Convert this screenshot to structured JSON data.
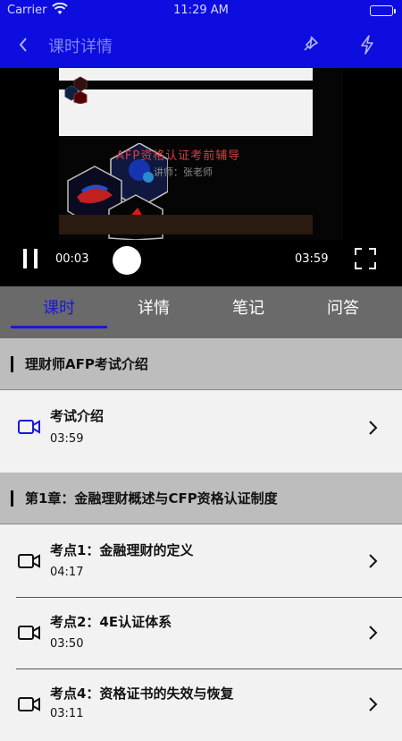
{
  "status_bar": {
    "carrier": "Carrier",
    "time": "11:29 AM"
  },
  "nav": {
    "title": "课时详情",
    "icons": [
      "back-icon",
      "pin-icon",
      "bolt-icon"
    ]
  },
  "video": {
    "slide_title": "AFP资格认证考前辅导",
    "slide_subtitle": "讲师：张老师",
    "current_time": "00:03",
    "total_time": "03:59",
    "progress": 0.013
  },
  "tabs": [
    {
      "label": "课时",
      "active": true
    },
    {
      "label": "详情",
      "active": false
    },
    {
      "label": "笔记",
      "active": false
    },
    {
      "label": "问答",
      "active": false
    }
  ],
  "sections": [
    {
      "title": "理财师AFP考试介绍",
      "lessons": [
        {
          "title": "考试介绍",
          "duration": "03:59",
          "playing": true
        }
      ]
    },
    {
      "title": "第1章：金融理财概述与CFP资格认证制度",
      "lessons": [
        {
          "title": "考点1：金融理财的定义",
          "duration": "04:17",
          "playing": false
        },
        {
          "title": "考点2：4E认证体系",
          "duration": "03:50",
          "playing": false
        },
        {
          "title": "考点4：资格证书的失效与恢复",
          "duration": "03:11",
          "playing": false
        }
      ]
    }
  ],
  "colors": {
    "brand": "#0d0de0",
    "accent": "#1919d8",
    "tab_bar": "#6a6a6a",
    "section_bg": "#bdbdbd"
  }
}
